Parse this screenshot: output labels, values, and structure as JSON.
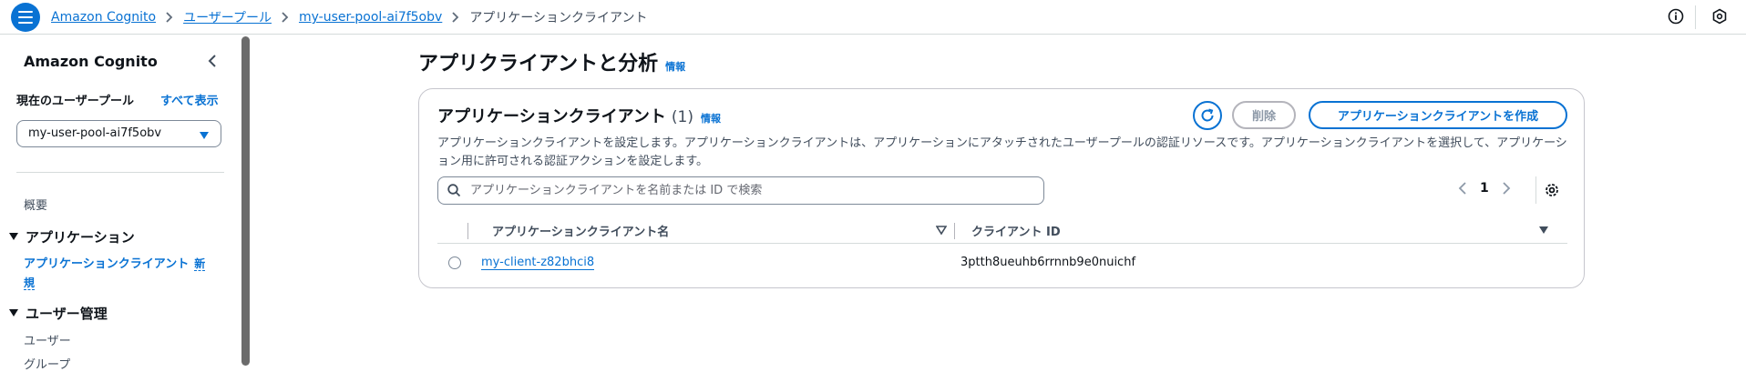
{
  "breadcrumb": {
    "items": [
      "Amazon Cognito",
      "ユーザープール",
      "my-user-pool-ai7f5obv"
    ],
    "current": "アプリケーションクライアント"
  },
  "sidebar": {
    "title": "Amazon Cognito",
    "current_pool_label": "現在のユーザープール",
    "show_all": "すべて表示",
    "pool_selected": "my-user-pool-ai7f5obv",
    "overview": "概要",
    "section_apps": "アプリケーション",
    "active_item": "アプリケーションクライアント",
    "new_badge": "新規",
    "section_users": "ユーザー管理",
    "items_users": [
      "ユーザー",
      "グループ"
    ]
  },
  "main": {
    "page_title": "アプリクライアントと分析",
    "info": "情報",
    "panel": {
      "title": "アプリケーションクライアント",
      "count": "(1)",
      "info": "情報",
      "delete_label": "削除",
      "create_label": "アプリケーションクライアントを作成",
      "description": "アプリケーションクライアントを設定します。アプリケーションクライアントは、アプリケーションにアタッチされたユーザープールの認証リソースです。アプリケーションクライアントを選択して、アプリケーション用に許可される認証アクションを設定します。",
      "search_placeholder": "アプリケーションクライアントを名前または ID で検索",
      "page_number": "1",
      "columns": [
        "アプリケーションクライアント名",
        "クライアント ID"
      ],
      "rows": [
        {
          "name": "my-client-z82bhci8",
          "client_id": "3ptth8ueuhb6rrnnb9e0nuichf"
        }
      ]
    }
  },
  "colors": {
    "accent": "#0972d3",
    "text": "#0f141a",
    "muted": "#414d5c",
    "border": "#c6c6cd"
  }
}
